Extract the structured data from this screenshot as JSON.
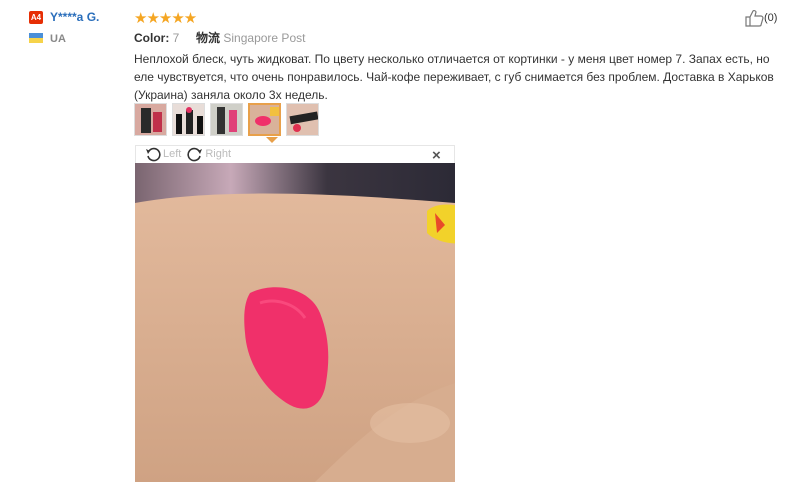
{
  "reviewer": {
    "badge": "A4",
    "name": "Y****a G.",
    "country": "UA"
  },
  "rating": {
    "stars": "★★★★★",
    "value": 5,
    "max": 5
  },
  "meta": {
    "color_label": "Color:",
    "color_value": "7",
    "shipping_label": "物流",
    "shipping_value": "Singapore Post"
  },
  "helpful": {
    "count": "(0)"
  },
  "review_text": "Неплохой блеск, чуть жидковат. По цвету несколько отличается от кортинки - у меня цвет номер 7. Запах есть, но еле чувствуется, что очень понравилось. Чай-кофе переживает, с губ снимается без проблем. Доставка в Харьков (Украина) заняла около 3х недель.",
  "viewer": {
    "left_label": "Left",
    "right_label": "Right",
    "close": "×"
  },
  "thumbnails": {
    "count": 5,
    "selected_index": 3
  },
  "colors": {
    "accent": "#e8a04a",
    "link": "#2a6ebb",
    "star": "#f5a623",
    "swatch": "#f0306a"
  }
}
